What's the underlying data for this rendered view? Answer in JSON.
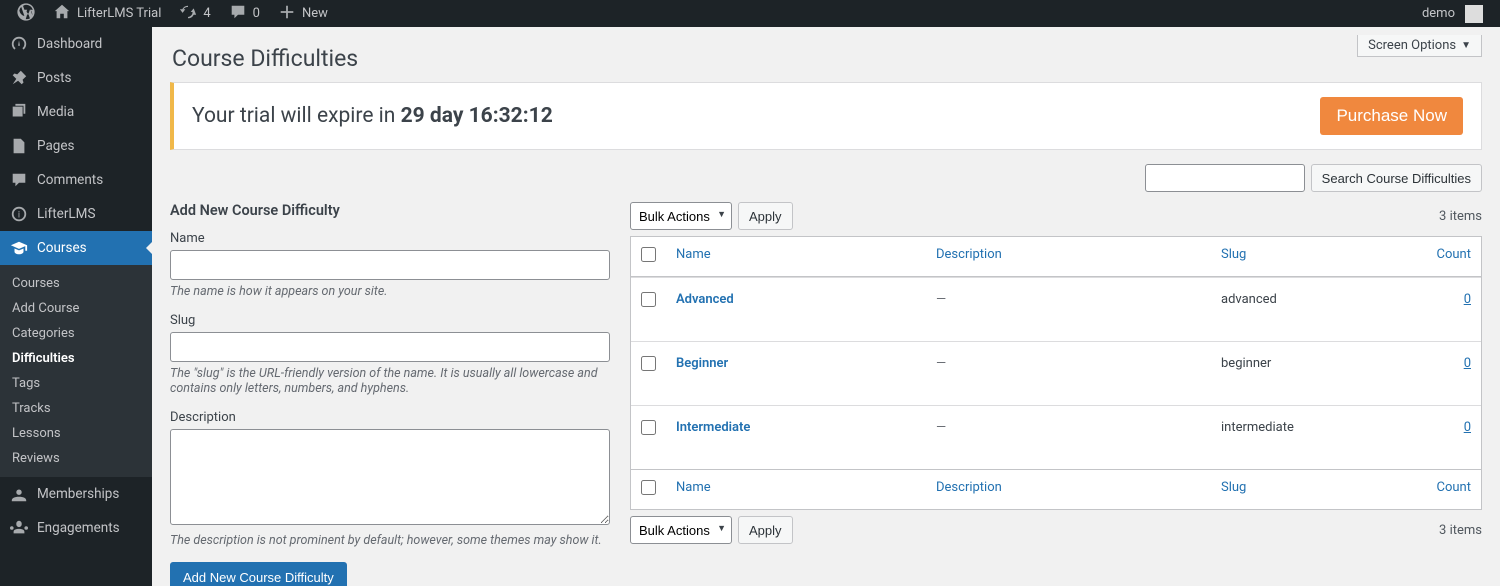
{
  "adminbar": {
    "site_title": "LifterLMS Trial",
    "updates_count": "4",
    "comments_count": "0",
    "new_label": "New",
    "user_label": "demo"
  },
  "sidebar": {
    "items": [
      {
        "key": "dashboard",
        "label": "Dashboard"
      },
      {
        "key": "posts",
        "label": "Posts"
      },
      {
        "key": "media",
        "label": "Media"
      },
      {
        "key": "pages",
        "label": "Pages"
      },
      {
        "key": "comments",
        "label": "Comments"
      },
      {
        "key": "lifterlms",
        "label": "LifterLMS"
      },
      {
        "key": "courses",
        "label": "Courses"
      },
      {
        "key": "memberships",
        "label": "Memberships"
      },
      {
        "key": "engagements",
        "label": "Engagements"
      }
    ],
    "courses_submenu": [
      {
        "key": "courses",
        "label": "Courses"
      },
      {
        "key": "addcourse",
        "label": "Add Course"
      },
      {
        "key": "categories",
        "label": "Categories"
      },
      {
        "key": "difficulties",
        "label": "Difficulties"
      },
      {
        "key": "tags",
        "label": "Tags"
      },
      {
        "key": "tracks",
        "label": "Tracks"
      },
      {
        "key": "lessons",
        "label": "Lessons"
      },
      {
        "key": "reviews",
        "label": "Reviews"
      }
    ]
  },
  "page": {
    "screen_options": "Screen Options",
    "title": "Course Difficulties",
    "trial_prefix": "Your trial will expire in ",
    "trial_countdown": "29 day 16:32:12",
    "purchase_label": "Purchase Now",
    "search_button": "Search Course Difficulties"
  },
  "form": {
    "heading": "Add New Course Difficulty",
    "name_label": "Name",
    "name_desc": "The name is how it appears on your site.",
    "slug_label": "Slug",
    "slug_desc": "The \"slug\" is the URL-friendly version of the name. It is usually all lowercase and contains only letters, numbers, and hyphens.",
    "desc_label": "Description",
    "desc_desc": "The description is not prominent by default; however, some themes may show it.",
    "submit_label": "Add New Course Difficulty"
  },
  "table": {
    "bulk_label": "Bulk Actions",
    "apply_label": "Apply",
    "item_count": "3 items",
    "headers": {
      "name": "Name",
      "description": "Description",
      "slug": "Slug",
      "count": "Count"
    },
    "rows": [
      {
        "name": "Advanced",
        "description": "—",
        "slug": "advanced",
        "count": "0"
      },
      {
        "name": "Beginner",
        "description": "—",
        "slug": "beginner",
        "count": "0"
      },
      {
        "name": "Intermediate",
        "description": "—",
        "slug": "intermediate",
        "count": "0"
      }
    ]
  }
}
